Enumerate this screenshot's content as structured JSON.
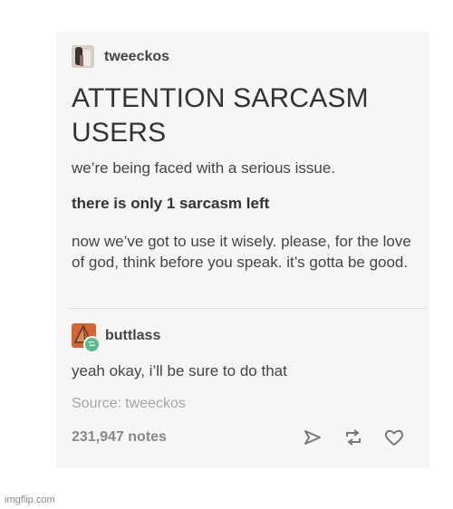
{
  "post": {
    "author": "tweeckos",
    "title": "ATTENTION SARCASM USERS",
    "paragraph1": "we’re being faced with a serious issue.",
    "paragraph2": "there is only 1 sarcasm left",
    "paragraph3": "now we’ve got to use it wisely. please, for the love of god, think before you speak. it’s gotta be good."
  },
  "reblog": {
    "author": "buttlass",
    "text": "yeah okay, i’ll be sure to do that"
  },
  "source": {
    "label": "Source:",
    "value": "tweeckos"
  },
  "footer": {
    "notes": "231,947 notes",
    "icons": [
      "share-icon",
      "reblog-icon",
      "like-icon"
    ]
  },
  "watermark": "imgflip.com",
  "colors": {
    "avatar2": "#d66433",
    "reblog_badge": "#56bc8a"
  }
}
